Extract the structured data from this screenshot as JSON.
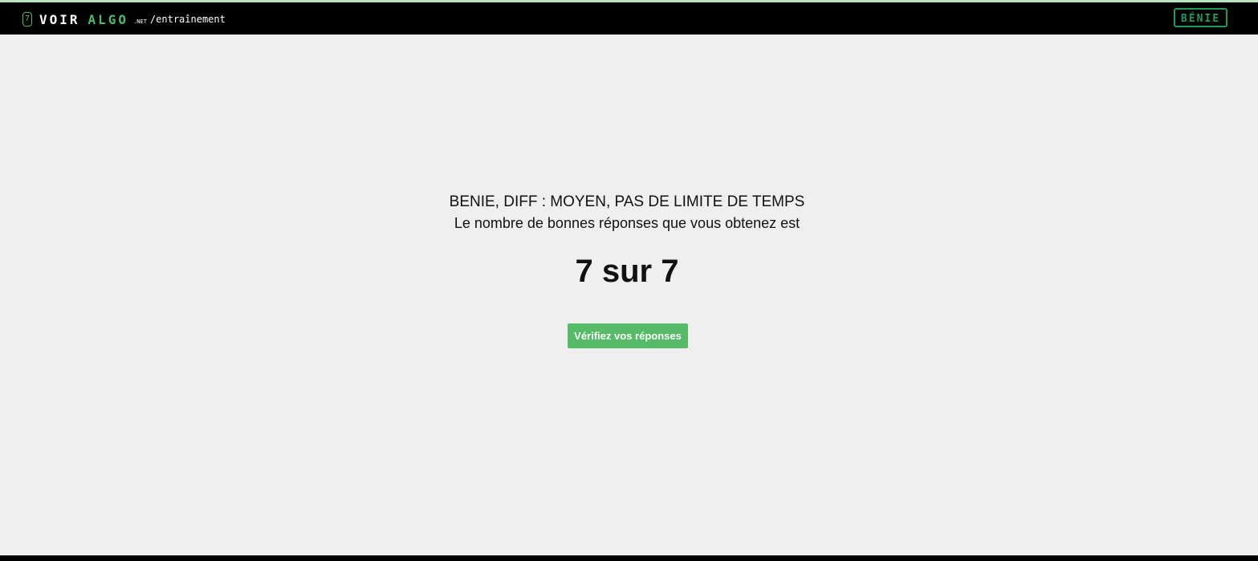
{
  "header": {
    "logo_badge": "7",
    "logo_voir": "VOIR",
    "logo_algo": "ALGO",
    "logo_net": ".NET",
    "path": "/entraînement",
    "user_button_label": "BÉNIE"
  },
  "result": {
    "subtitle": "BENIE, DIFF : MOYEN, PAS DE LIMITE DE TEMPS",
    "message": "Le nombre de bonnes réponses que vous obtenez est",
    "score": "7 sur 7",
    "check_button_label": "Vérifiez vos réponses"
  },
  "colors": {
    "accent_green": "#4cbb6b",
    "button_green": "#55bb66",
    "user_button_green": "#1f9a5d",
    "navbar_bg": "#000000",
    "page_bg": "#efefef"
  }
}
